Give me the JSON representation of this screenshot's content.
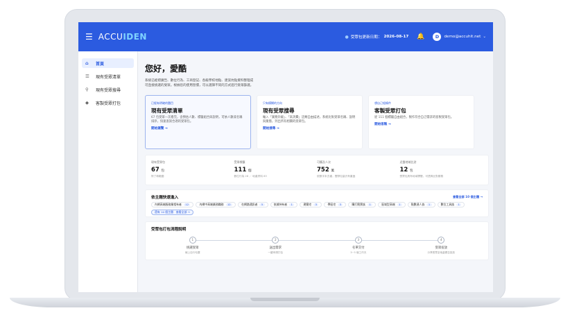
{
  "navbar": {
    "logo_prefix": "ACCU",
    "logo_suffix": "IDEN",
    "update_label": "受眾包更新日期：",
    "update_date": "2026-08-17",
    "avatar_letter": "D",
    "email": "demo@accuhit.net"
  },
  "sidebar": {
    "items": [
      {
        "label": "首頁",
        "icon": "home-icon"
      },
      {
        "label": "現有受眾清單",
        "icon": "list-icon"
      },
      {
        "label": "現有受眾搜尋",
        "icon": "search-icon"
      },
      {
        "label": "客製受眾打包",
        "icon": "tag-icon"
      }
    ]
  },
  "main": {
    "greeting": "您好，愛酷",
    "intro_line1": "系統已經把廣告、數位行為、工商登記、各級學校地點、建案坑點資料整理成",
    "intro_line2": "可直接挑選的受眾。根據您的使用習慣，可以選擇不同的方式進行受眾篩選。",
    "cards": [
      {
        "tag": "已經有明確的題目",
        "title": "現有受眾清單",
        "desc": "67 包受眾一次看完，含預估人數、標籤組合與說明，可依人數或名稱排序，快速查詢合適的受眾包。",
        "link": "開始瀏覽 →"
      },
      {
        "tag": "只有模糊的方向",
        "title": "現有受眾搜尋",
        "desc": "輸入「業務升級」、「高消費」這類自由描述，系統比對受眾名稱、說明與業態，列出所有相關的受眾包。",
        "link": "開始搜尋 →"
      },
      {
        "tag": "想自己組條件",
        "title": "客製受眾打包",
        "desc": "從 111 個標籤自由組合，製作符合自己需求的客製受眾包。",
        "link": "開始客製 →"
      }
    ],
    "stats": [
      {
        "label": "現有受眾包",
        "value": "67",
        "unit": "包",
        "sub": "除了和範圍"
      },
      {
        "label": "受眾標籤",
        "value": "111",
        "unit": "個",
        "sub": "數位行為 28 ／ 地產資料 83"
      },
      {
        "label": "可觸及人次",
        "value": "752",
        "unit": "萬",
        "sub": "依數字未去重，實際包量仍有重疊"
      },
      {
        "label": "近盤地域比對",
        "value": "12",
        "unit": "包",
        "sub": "受眾包具有地域標籤，可透夠比對服務"
      }
    ],
    "quick": {
      "title": "依主題快速進入",
      "view_all": "查看全部 10 個主題 →",
      "chips": [
        {
          "label": "內網高端服務業相有者",
          "count": "12"
        },
        {
          "label": "內網中高端業務職務",
          "count": "12"
        },
        {
          "label": "在網路通訊者",
          "count": "5"
        },
        {
          "label": "依據持有者",
          "count": "1"
        },
        {
          "label": "建築宅",
          "count": "3"
        },
        {
          "label": "學區宅",
          "count": "3"
        },
        {
          "label": "購打競票族",
          "count": "1"
        },
        {
          "label": "區域型高端",
          "count": "1"
        },
        {
          "label": "點數達人族",
          "count": "1"
        },
        {
          "label": "數位工具族",
          "count": "1"
        },
        {
          "label": "還有 10 個主題　查看全部 →",
          "count": ""
        }
      ]
    },
    "process": {
      "title": "受眾包打包流程說明",
      "steps": [
        {
          "num": "1",
          "name": "挑選受眾",
          "desc": "線上自行勾選"
        },
        {
          "num": "2",
          "name": "送出需求",
          "desc": "一鍵申請打包"
        },
        {
          "num": "3",
          "name": "名單交付",
          "desc": "3~5 個工作天"
        },
        {
          "num": "4",
          "name": "受眾投放",
          "desc": "分享受眾至他處廣告投放"
        }
      ]
    }
  },
  "colors": {
    "brand": "#2b5be0",
    "accent": "#7fd3ff"
  }
}
